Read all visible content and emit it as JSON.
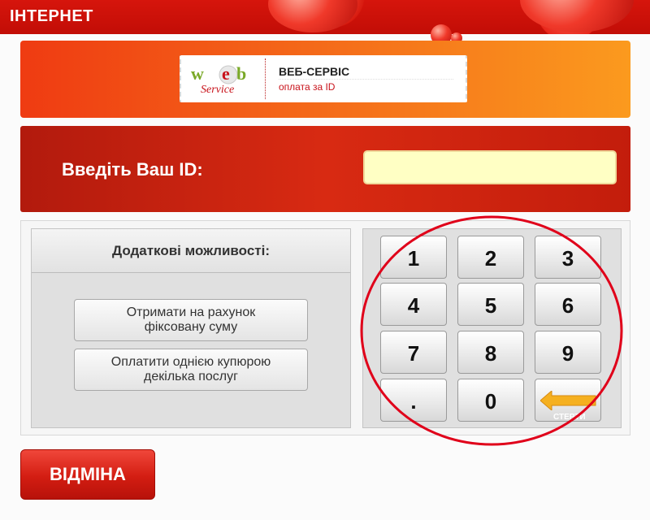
{
  "top_bar": {
    "title": "ІНТЕРНЕТ"
  },
  "service": {
    "logo_text": "WEB",
    "logo_script": "Service",
    "name": "ВЕБ-СЕРВІС",
    "subtitle": "оплата за ID"
  },
  "id_entry": {
    "label": "Введіть Ваш ID:",
    "value": ""
  },
  "options": {
    "heading": "Додаткові можливості:",
    "buttons": [
      {
        "line1": "Отримати на рахунок",
        "line2": "фіксовану суму"
      },
      {
        "line1": "Оплатити однією купюрою",
        "line2": "декілька послуг"
      }
    ]
  },
  "keypad": {
    "keys": [
      "1",
      "2",
      "3",
      "4",
      "5",
      "6",
      "7",
      "8",
      "9",
      ".",
      "0"
    ],
    "erase_label": "СТЕРТИ"
  },
  "cancel_label": "ВІДМІНА",
  "colors": {
    "brand_red": "#d31d12",
    "orange": "#f5701a",
    "input_bg": "#ffffc4",
    "annotation": "#e0001a"
  }
}
